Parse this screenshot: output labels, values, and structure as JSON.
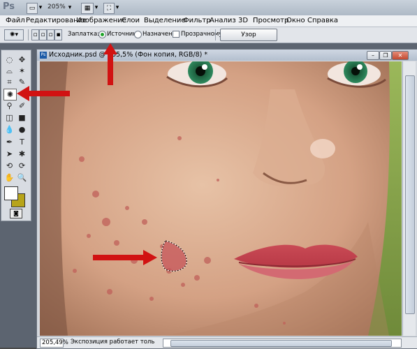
{
  "app": {
    "logo": "Ps",
    "zoom": "205%"
  },
  "menu": [
    "Файл",
    "Редактирование",
    "Изображение",
    "Слои",
    "Выделение",
    "Фильтр",
    "Анализ",
    "3D",
    "Просмотр",
    "Окно",
    "Справка"
  ],
  "options": {
    "patch_label": "Заплатка:",
    "source_label": "Источник",
    "destination_label": "Назначение",
    "transparent_label": "Прозрачному",
    "pattern_button": "Узор",
    "swatch_color": "#a7b6c9"
  },
  "document": {
    "title": "Исходник.psd @ 205,5% (Фон копия, RGB/8) *",
    "ps_badge": "Ps",
    "zoom_value": "205,49%",
    "status_text": "Экспозиция работает только в ..."
  },
  "colors": {
    "foreground": "#ffffff",
    "background": "#b7a419",
    "arrow": "#d11212"
  }
}
